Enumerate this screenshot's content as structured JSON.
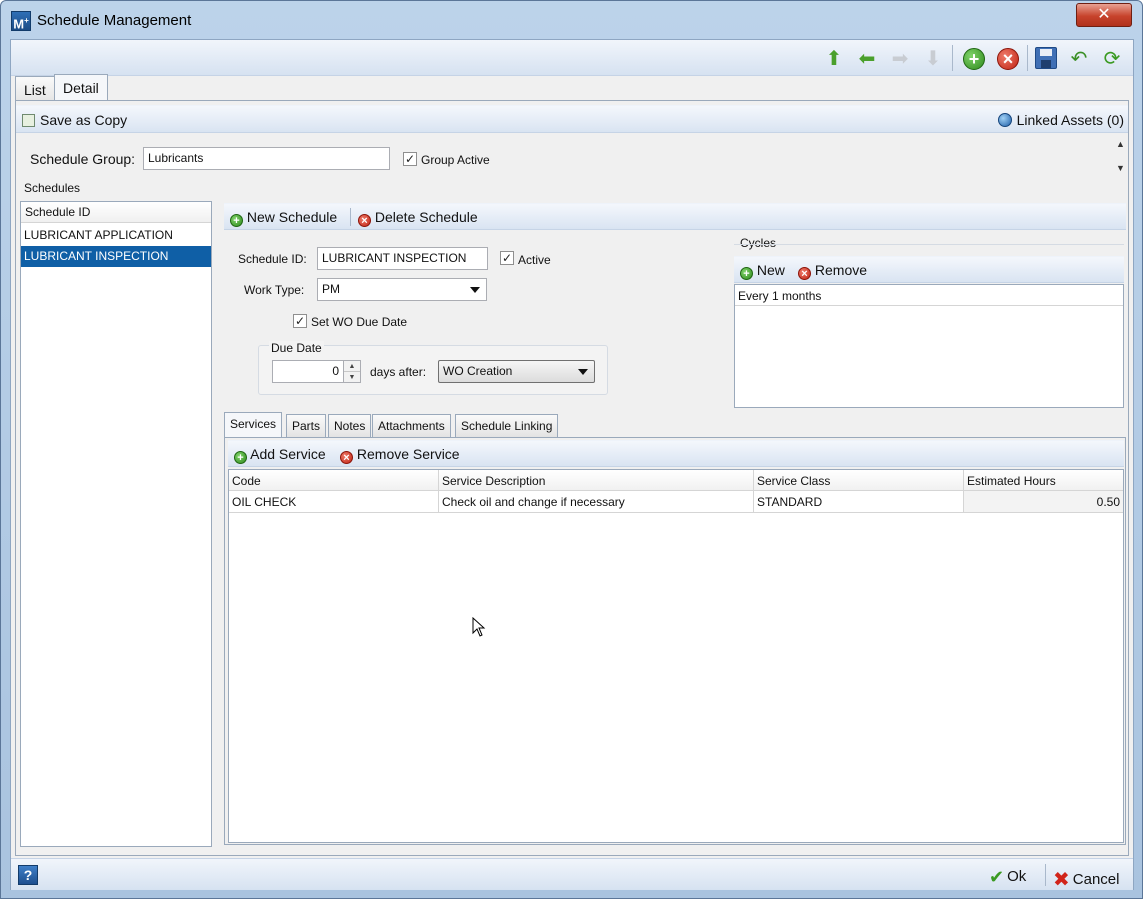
{
  "window": {
    "title": "Schedule Management"
  },
  "top_tabs": [
    "List",
    "Detail"
  ],
  "detail_bar": {
    "save_copy": "Save as Copy",
    "linked_assets": "Linked Assets (0)"
  },
  "schedule_group": {
    "label": "Schedule Group:",
    "value": "Lubricants",
    "group_active_label": "Group Active",
    "group_active_checked": true
  },
  "schedules": {
    "title": "Schedules",
    "header": "Schedule ID",
    "items": [
      "LUBRICANT APPLICATION",
      "LUBRICANT INSPECTION"
    ],
    "selected_index": 1
  },
  "schedule_actions": {
    "new": "New Schedule",
    "delete": "Delete Schedule"
  },
  "schedule_form": {
    "id_label": "Schedule ID:",
    "id_value": "LUBRICANT INSPECTION",
    "active_label": "Active",
    "work_type_label": "Work Type:",
    "work_type_value": "PM",
    "set_wo_due_label": "Set WO Due Date",
    "due_date_title": "Due Date",
    "due_days": "0",
    "days_after_label": "days after:",
    "days_after_value": "WO Creation"
  },
  "cycles": {
    "title": "Cycles",
    "new": "New",
    "remove": "Remove",
    "items": [
      "Every 1 months"
    ]
  },
  "sub_tabs": [
    "Services",
    "Parts",
    "Notes",
    "Attachments",
    "Schedule Linking"
  ],
  "services_actions": {
    "add": "Add Service",
    "remove": "Remove Service"
  },
  "services_table": {
    "columns": [
      "Code",
      "Service Description",
      "Service Class",
      "Estimated Hours"
    ],
    "rows": [
      {
        "code": "OIL CHECK",
        "description": "Check oil and change if necessary",
        "class": "STANDARD",
        "hours": "0.50"
      }
    ]
  },
  "footer": {
    "help": "?",
    "ok": "Ok",
    "cancel": "Cancel"
  }
}
